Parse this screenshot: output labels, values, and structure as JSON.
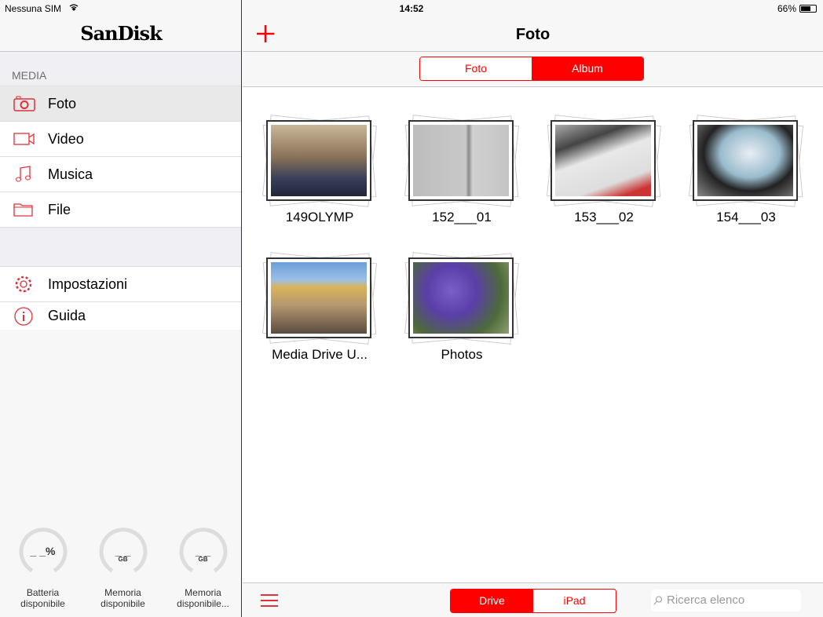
{
  "status": {
    "carrier": "Nessuna SIM",
    "time": "14:52",
    "battery": "66%",
    "battery_level": 0.66
  },
  "sidebar": {
    "logo": "SanDisk",
    "section": "MEDIA",
    "media": [
      {
        "label": "Foto",
        "icon": "camera-icon"
      },
      {
        "label": "Video",
        "icon": "video-icon"
      },
      {
        "label": "Musica",
        "icon": "music-icon"
      },
      {
        "label": "File",
        "icon": "folder-icon"
      }
    ],
    "other": [
      {
        "label": "Impostazioni",
        "icon": "gear-icon"
      },
      {
        "label": "Guida",
        "icon": "info-icon"
      }
    ],
    "gauges": [
      {
        "value": "_ _%",
        "unit": "",
        "label1": "Batteria",
        "label2": "disponibile"
      },
      {
        "value": "_ _",
        "unit": "GB",
        "label1": "Memoria",
        "label2": "disponibile"
      },
      {
        "value": "_ _",
        "unit": "GB",
        "label1": "Memoria",
        "label2": "disponibile..."
      }
    ]
  },
  "main": {
    "title": "Foto",
    "tabs": [
      "Foto",
      "Album"
    ],
    "active_tab": "Album",
    "albums": [
      {
        "name": "149OLYMP"
      },
      {
        "name": "152___01"
      },
      {
        "name": "153___02"
      },
      {
        "name": "154___03"
      },
      {
        "name": "Media Drive U..."
      },
      {
        "name": "Photos"
      }
    ],
    "source": [
      "Drive",
      "iPad"
    ],
    "active_source": "Drive",
    "search_placeholder": "Ricerca elenco"
  },
  "colors": {
    "accent": "#ff0000"
  }
}
